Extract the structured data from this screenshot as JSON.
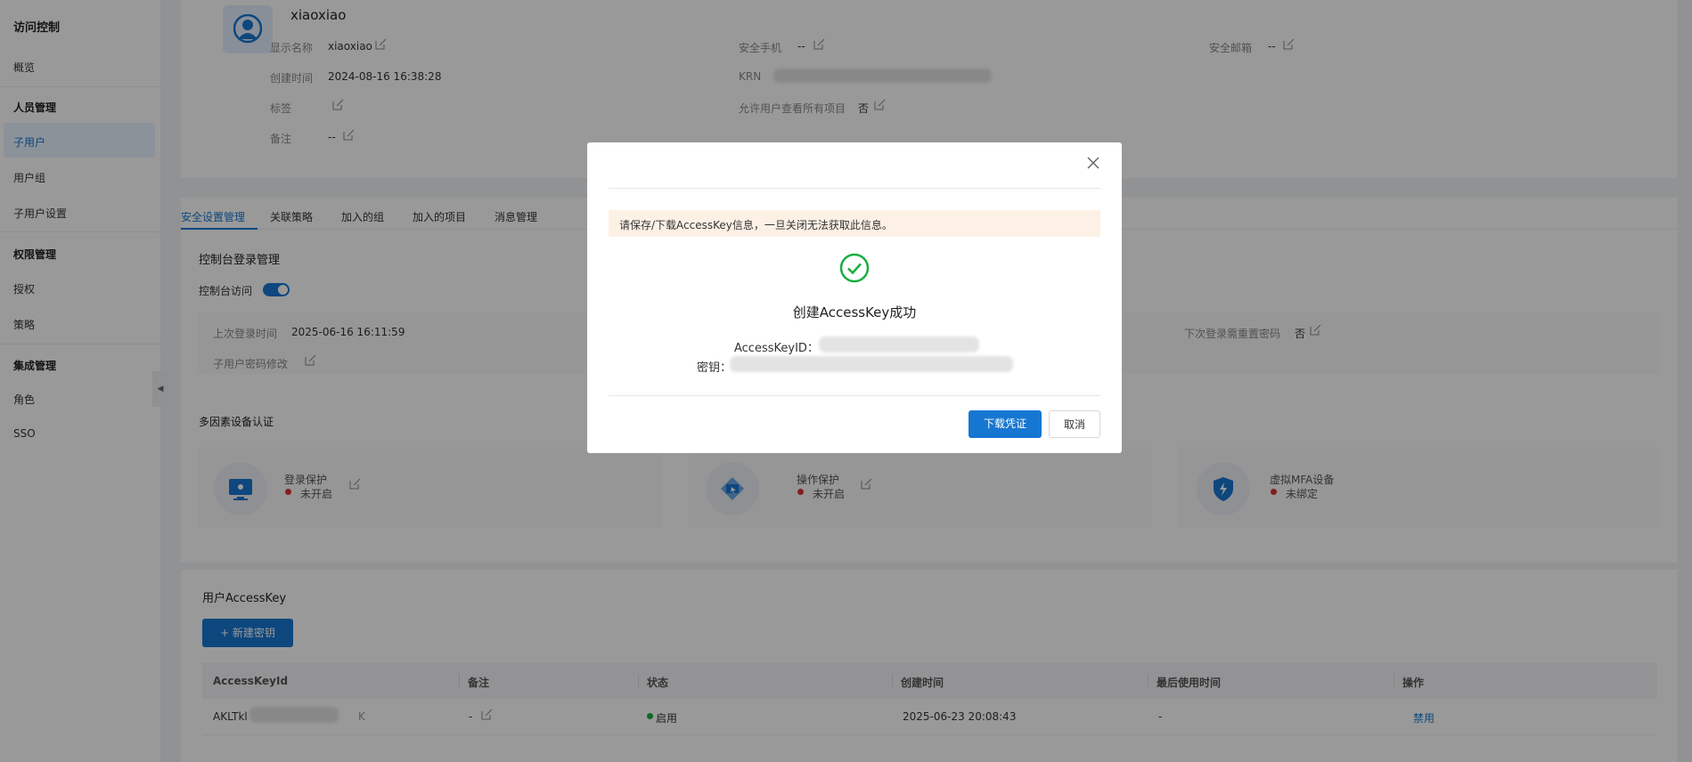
{
  "sidebar": {
    "title": "访问控制",
    "overview": "概览",
    "groups": [
      {
        "label": "人员管理",
        "items": [
          "子用户",
          "用户组",
          "子用户设置"
        ]
      },
      {
        "label": "权限管理",
        "items": [
          "授权",
          "策略"
        ]
      },
      {
        "label": "集成管理",
        "items": [
          "角色",
          "SSO"
        ]
      }
    ]
  },
  "user": {
    "name": "xiaoxiao",
    "display_name_label": "显示名称",
    "display_name_value": "xiaoxiao",
    "created_label": "创建时间",
    "created_value": "2024-08-16 16:38:28",
    "tag_label": "标签",
    "remark_label": "备注",
    "remark_value": "--",
    "phone_label": "安全手机",
    "phone_value": "--",
    "krn_label": "KRN",
    "allow_view_label": "允许用户查看所有项目",
    "allow_view_value": "否",
    "email_label": "安全邮箱",
    "email_value": "--"
  },
  "tabs": [
    "安全设置管理",
    "关联策略",
    "加入的组",
    "加入的项目",
    "消息管理"
  ],
  "console": {
    "section_title": "控制台登录管理",
    "access_label": "控制台访问",
    "last_login_label": "上次登录时间",
    "last_login_value": "2025-06-16 16:11:59",
    "pwd_change_label": "子用户密码修改",
    "reset_pwd_label": "下次登录需重置密码",
    "reset_pwd_value": "否"
  },
  "mfa": {
    "section_title": "多因素设备认证",
    "items": [
      {
        "label": "登录保护",
        "status": "未开启"
      },
      {
        "label": "操作保护",
        "status": "未开启"
      },
      {
        "label": "虚拟MFA设备",
        "status": "未绑定"
      }
    ]
  },
  "accesskey": {
    "section_title": "用户AccessKey",
    "new_button": "+ 新建密钥",
    "columns": [
      "AccessKeyId",
      "备注",
      "状态",
      "创建时间",
      "最后使用时间",
      "操作"
    ],
    "rows": [
      {
        "id_prefix": "AKLTkl",
        "id_suffix": "K",
        "remark": "-",
        "status": "启用",
        "created": "2025-06-23 20:08:43",
        "last_used": "-",
        "action": "禁用"
      }
    ]
  },
  "modal": {
    "alert": "请保存/下载AccessKey信息，一旦关闭无法获取此信息。",
    "title": "创建AccessKey成功",
    "key_id_label": "AccessKeyID：",
    "secret_label": "密钥：",
    "download_button": "下载凭证",
    "cancel_button": "取消"
  },
  "colors": {
    "primary": "#1677d2",
    "success": "#1aad3f",
    "danger": "#e03131",
    "alert_bg": "#fdf1e6"
  }
}
